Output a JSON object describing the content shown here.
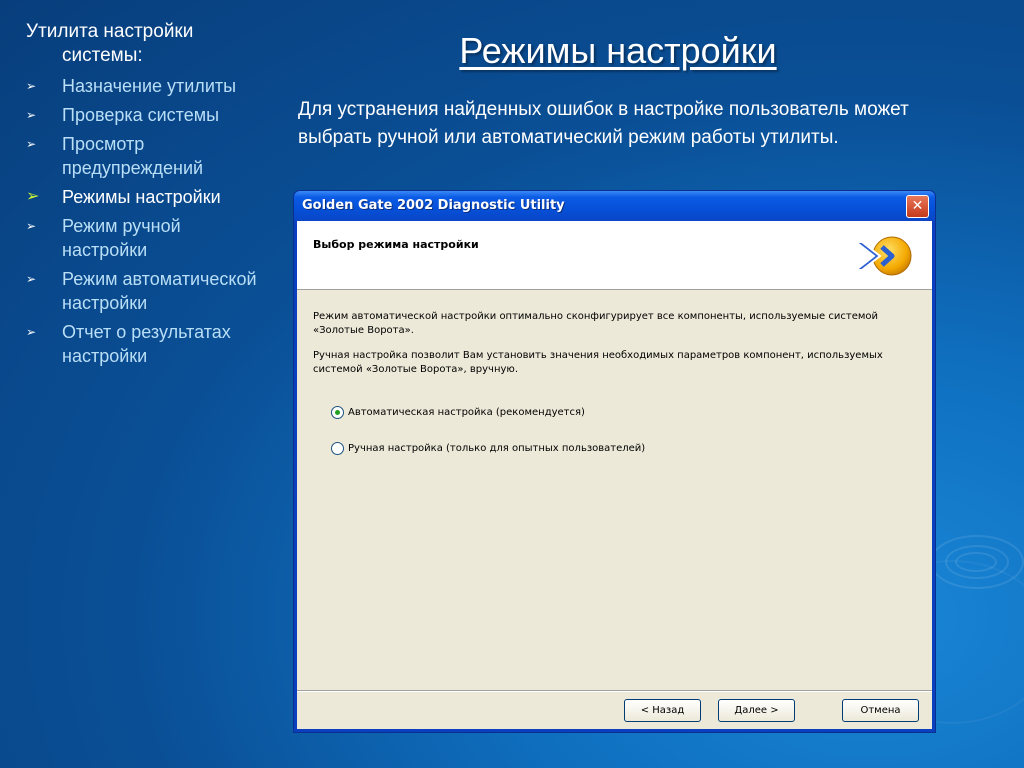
{
  "sidebar": {
    "heading_line1": "Утилита настройки",
    "heading_line2": "системы:",
    "items": [
      {
        "label": "Назначение утилиты"
      },
      {
        "label": "Проверка системы"
      },
      {
        "label": "Просмотр предупреждений"
      },
      {
        "label": "Режимы настройки"
      },
      {
        "label": "Режим ручной настройки"
      },
      {
        "label": "Режим автоматической настройки"
      },
      {
        "label": "Отчет о результатах настройки"
      }
    ],
    "active_index": 3
  },
  "slide": {
    "title": "Режимы настройки",
    "intro": "Для устранения найденных ошибок в настройке пользователь может выбрать ручной или автоматический режим работы утилиты."
  },
  "dialog": {
    "window_title": "Golden Gate 2002 Diagnostic Utility",
    "header": "Выбор режима настройки",
    "para1": "Режим автоматической настройки оптимально сконфигурирует все компоненты, используемые системой «Золотые Ворота».",
    "para2": "Ручная настройка позволит Вам установить значения необходимых параметров компонент, используемых системой «Золотые Ворота», вручную.",
    "radio_auto": "Автоматическая настройка (рекомендуется)",
    "radio_manual": "Ручная настройка (только для опытных пользователей)",
    "selected": "auto",
    "btn_back": "< Назад",
    "btn_next": "Далее >",
    "btn_cancel": "Отмена",
    "close_glyph": "✕"
  },
  "colors": {
    "background": "#0a4f96",
    "active_bullet": "#c7f23a",
    "titlebar": "#0550d8",
    "dialog_face": "#ece9d8"
  }
}
